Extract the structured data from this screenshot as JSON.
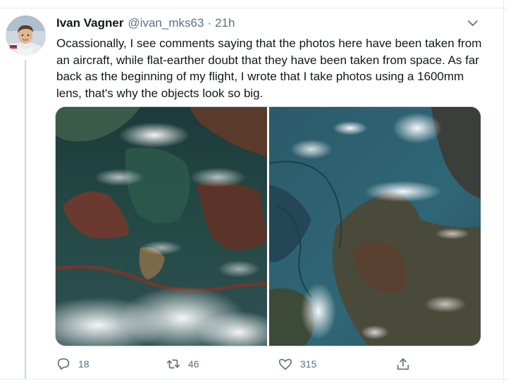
{
  "tweet": {
    "author_name": "Ivan Vagner",
    "handle": "@ivan_mks63",
    "separator": "·",
    "time": "21h",
    "text": "Ocassionally, I see comments saying that the photos here have been taken from an aircraft, while flat-earther doubt that they have been taken from space. As far back as the beginning of my flight, I wrote that I take photos using a 1600mm lens, that's why the objects look so big.",
    "media_count": 2
  },
  "actions": {
    "replies": "18",
    "retweets": "46",
    "likes": "315"
  },
  "icons": {
    "avatar": "astronaut-avatar",
    "menu": "chevron-down-icon",
    "reply": "reply-icon",
    "retweet": "retweet-icon",
    "like": "heart-icon",
    "share": "share-icon"
  },
  "colors": {
    "text": "#14171a",
    "secondary": "#5b7083",
    "divider": "#e6ecf0"
  }
}
